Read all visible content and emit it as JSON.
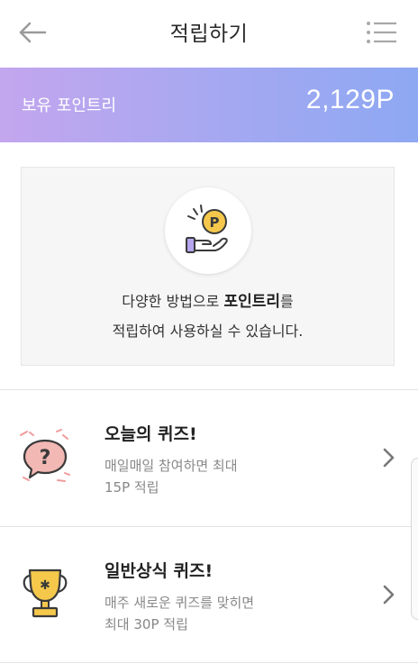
{
  "header": {
    "title": "적립하기",
    "back_icon": "arrow-left-icon",
    "menu_icon": "list-menu-icon"
  },
  "banner": {
    "label": "보유 포인트리",
    "value": "2,129P",
    "gradient": [
      "#c3a6ee",
      "#8ea8f2"
    ]
  },
  "info": {
    "icon": "coin-hand-icon",
    "line1_prefix": "다양한 방법으로 ",
    "line1_strong": "포인트리",
    "line1_suffix": "를",
    "line2": "적립하여 사용하실 수 있습니다."
  },
  "items": [
    {
      "title": "오늘의 퀴즈!",
      "desc1": "매일매일 참여하면 최대",
      "desc2": "15P 적립",
      "icon": "question-bubble-icon"
    },
    {
      "title": "일반상식 퀴즈!",
      "desc1": "매주 새로운 퀴즈를 맞히면",
      "desc2": "최대 30P 적립",
      "icon": "trophy-icon"
    }
  ]
}
